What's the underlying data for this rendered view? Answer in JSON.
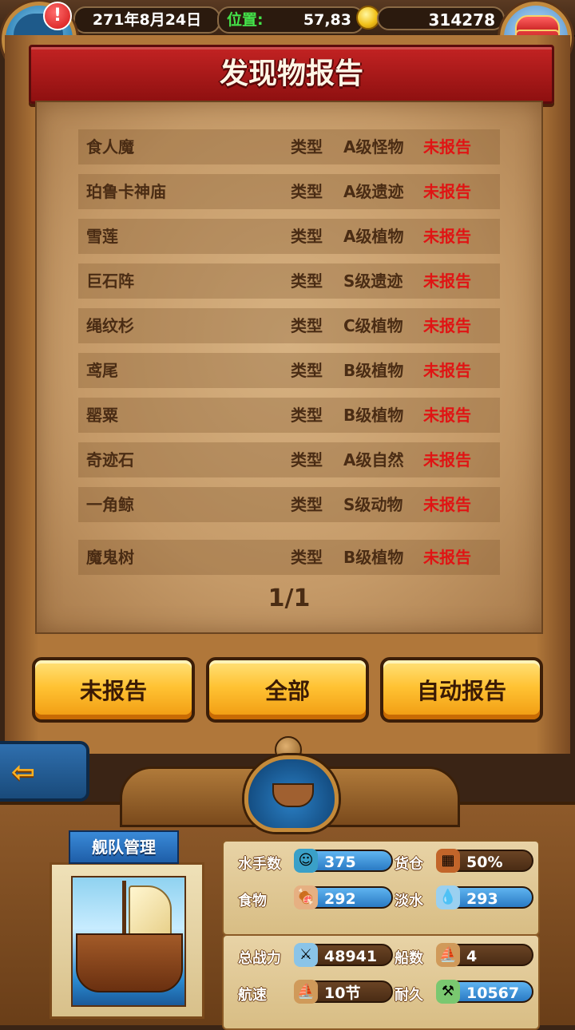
{
  "topbar": {
    "date": "271年8月24日",
    "position_label": "位置:",
    "position_value": "57,83",
    "gold": "314278",
    "alert": "!"
  },
  "title": "发现物报告",
  "type_label": "类型",
  "rows": [
    {
      "name": "食人魔",
      "type": "A级怪物",
      "status": "未报告"
    },
    {
      "name": "珀鲁卡神庙",
      "type": "A级遗迹",
      "status": "未报告"
    },
    {
      "name": "雪莲",
      "type": "A级植物",
      "status": "未报告"
    },
    {
      "name": "巨石阵",
      "type": "S级遗迹",
      "status": "未报告"
    },
    {
      "name": "绳纹杉",
      "type": "C级植物",
      "status": "未报告"
    },
    {
      "name": "鸢尾",
      "type": "B级植物",
      "status": "未报告"
    },
    {
      "name": "罂粟",
      "type": "B级植物",
      "status": "未报告"
    },
    {
      "name": "奇迹石",
      "type": "A级自然",
      "status": "未报告"
    },
    {
      "name": "一角鲸",
      "type": "S级动物",
      "status": "未报告"
    },
    {
      "name": "魔鬼树",
      "type": "B级植物",
      "status": "未报告"
    }
  ],
  "page_indicator": "1/1",
  "buttons": {
    "unreported": "未报告",
    "all": "全部",
    "auto_report": "自动报告"
  },
  "back_icon": "arrow-left-icon",
  "fleet": {
    "tag": "舰队管理",
    "sailors_label": "水手数",
    "sailors": "375",
    "cargo_label": "货仓",
    "cargo": "50%",
    "food_label": "食物",
    "food": "292",
    "water_label": "淡水",
    "water": "293",
    "power_label": "总战力",
    "power": "48941",
    "ships_label": "船数",
    "ships": "4",
    "speed_label": "航速",
    "speed": "10节",
    "durability_label": "耐久",
    "durability": "10567"
  },
  "colors": {
    "status_red": "#e01414",
    "title_red": "#c32323",
    "button_gold": "#ffc233",
    "pill_blue": "#2a7ac4"
  }
}
